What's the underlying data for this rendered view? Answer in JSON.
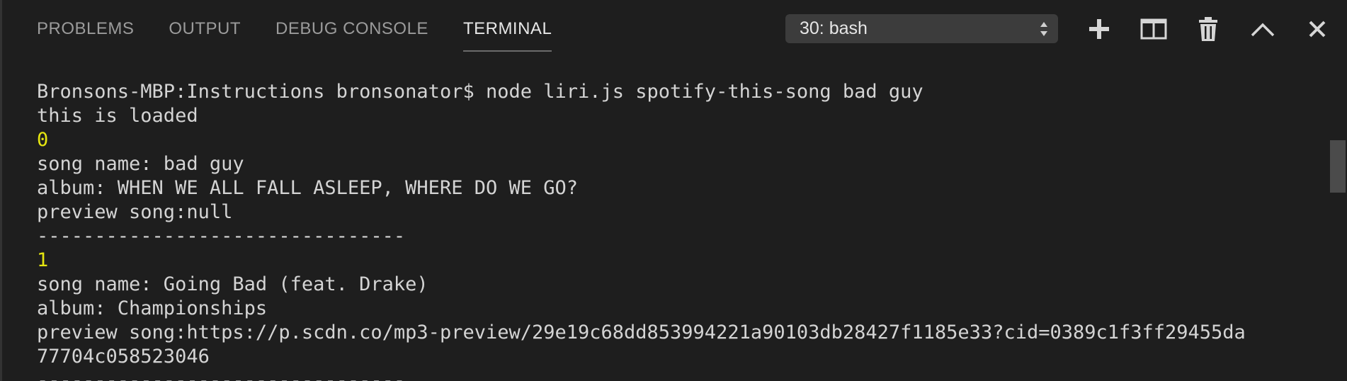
{
  "tabs": [
    {
      "label": "PROBLEMS"
    },
    {
      "label": "OUTPUT"
    },
    {
      "label": "DEBUG CONSOLE"
    },
    {
      "label": "TERMINAL",
      "active": true
    }
  ],
  "terminal_select": {
    "value": "30: bash"
  },
  "toolbar_icons": [
    "plus-icon",
    "split-icon",
    "trash-icon",
    "chevron-up-icon",
    "close-icon"
  ],
  "terminal": {
    "lines": [
      {
        "text": "Bronsons-MBP:Instructions bronsonator$ node liri.js spotify-this-song bad guy"
      },
      {
        "text": "this is loaded"
      },
      {
        "text": "0",
        "color": "#e5e510"
      },
      {
        "text": "song name: bad guy"
      },
      {
        "text": "album: WHEN WE ALL FALL ASLEEP, WHERE DO WE GO?"
      },
      {
        "text": "preview song:null"
      },
      {
        "text": "--------------------------------"
      },
      {
        "text": "1",
        "color": "#e5e510"
      },
      {
        "text": "song name: Going Bad (feat. Drake)"
      },
      {
        "text": "album: Championships"
      },
      {
        "text": "preview song:https://p.scdn.co/mp3-preview/29e19c68dd853994221a90103db28427f1185e33?cid=0389c1f3ff29455da"
      },
      {
        "text": "77704c058523046"
      },
      {
        "text": "--------------------------------"
      }
    ]
  },
  "colors": {
    "background": "#1e1e1e",
    "text": "#d4d4d4",
    "index": "#e5e510",
    "active_tab": "#e7e7e7",
    "inactive_tab": "#9b9b9b"
  }
}
